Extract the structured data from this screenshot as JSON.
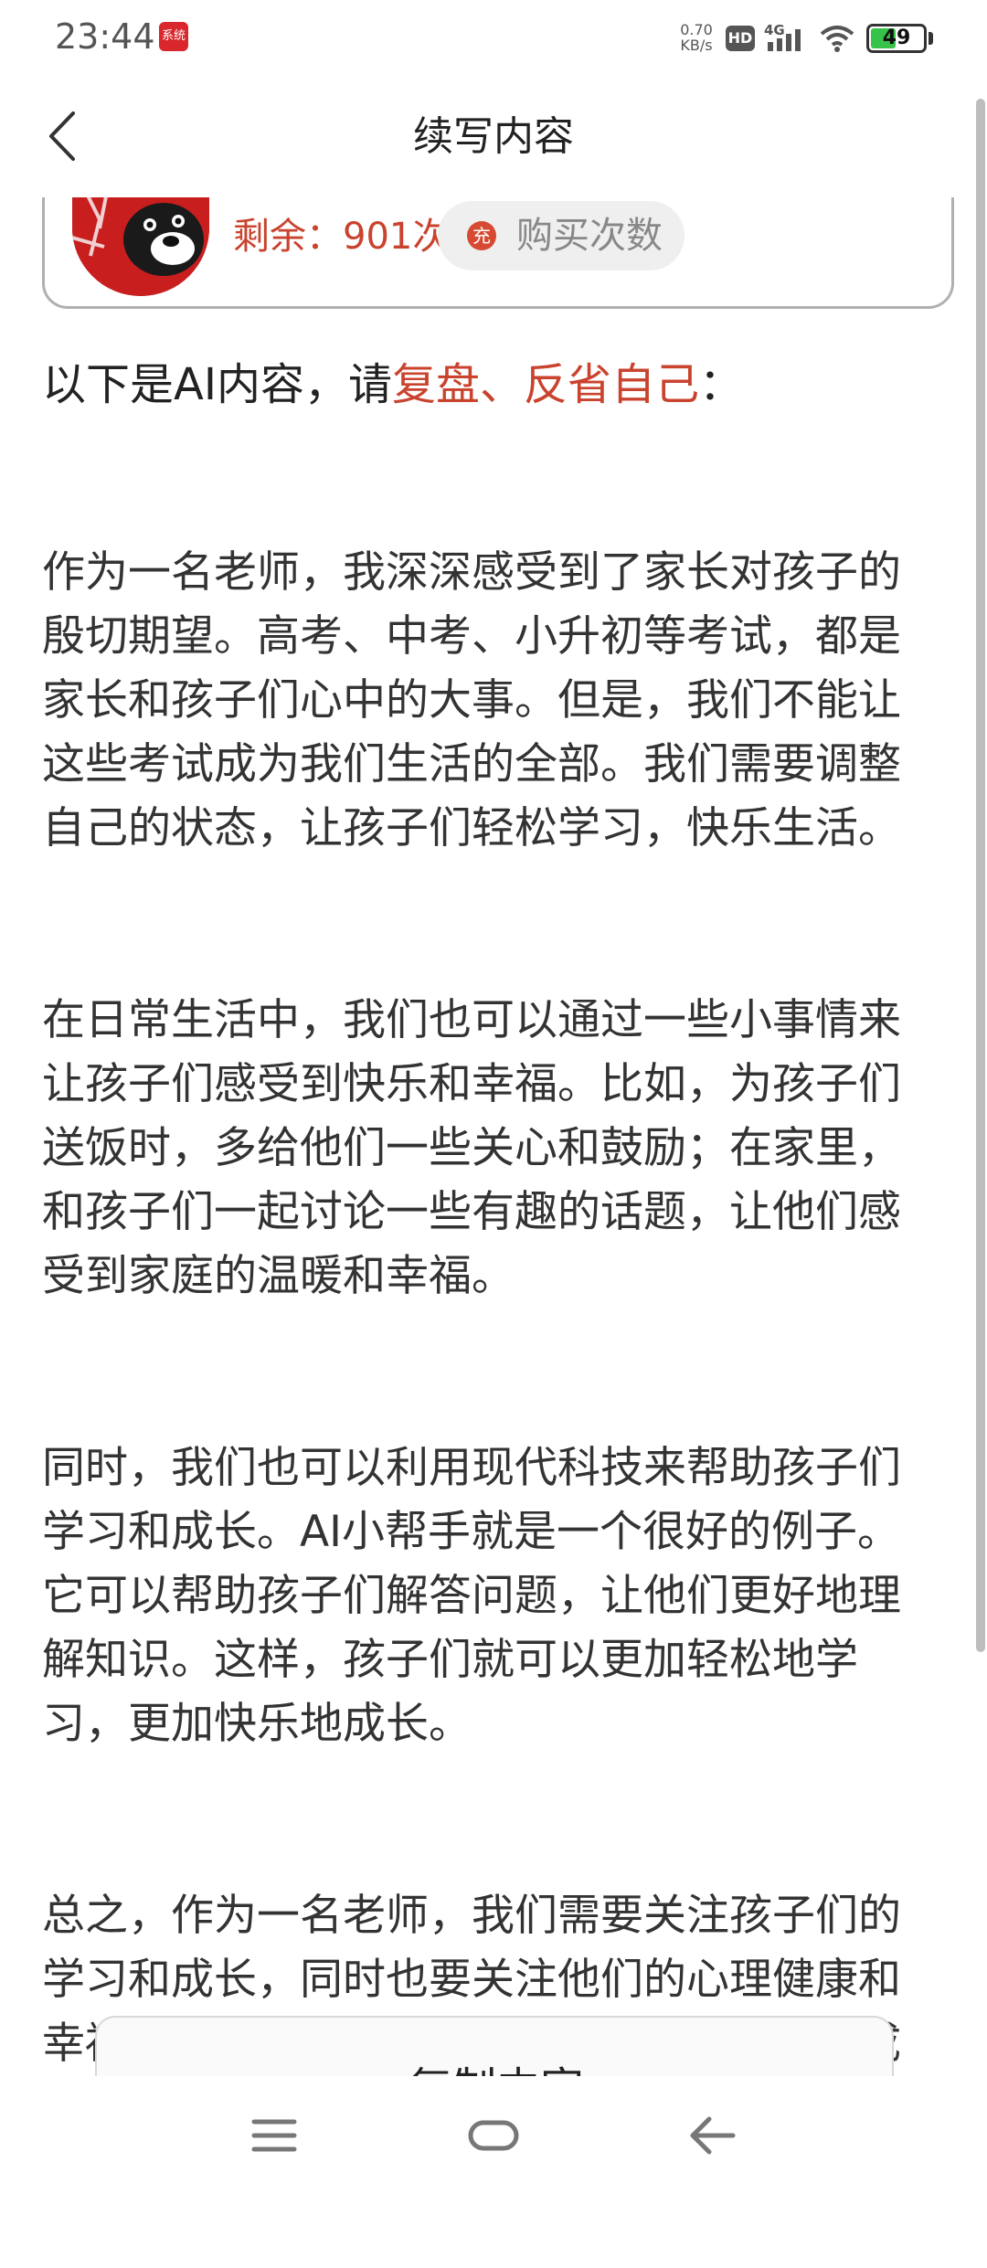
{
  "status_bar": {
    "time": "23:44",
    "app_badge": "系统",
    "net_speed_value": "0.70",
    "net_speed_unit": "KB/s",
    "hd_label": "HD",
    "network": "4G",
    "battery_level": "49",
    "battery_color": "#37c24a"
  },
  "header": {
    "title": "续写内容",
    "back_icon": "chevron-left-icon"
  },
  "quota": {
    "remaining_label": "剩余：",
    "remaining_count": "901次",
    "buy_icon_text": "充",
    "buy_label": "购买次数"
  },
  "intro": {
    "prefix": "以下是AI内容，请",
    "highlight": "复盘、反省自己",
    "suffix": "："
  },
  "article": {
    "paragraphs": [
      "作为一名老师，我深深感受到了家长对孩子的殷切期望。高考、中考、小升初等考试，都是家长和孩子们心中的大事。但是，我们不能让这些考试成为我们生活的全部。我们需要调整自己的状态，让孩子们轻松学习，快乐生活。",
      "在日常生活中，我们也可以通过一些小事情来让孩子们感受到快乐和幸福。比如，为孩子们送饭时，多给他们一些关心和鼓励；在家里，和孩子们一起讨论一些有趣的话题，让他们感受到家庭的温暖和幸福。",
      "同时，我们也可以利用现代科技来帮助孩子们学习和成长。AI小帮手就是一个很好的例子。它可以帮助孩子们解答问题，让他们更好地理解知识。这样，孩子们就可以更加轻松地学习，更加快乐地成长。",
      "总之，作为一名老师，我们需要关注孩子们的学习和成长，同时也要关注他们的心理健康和幸福感。只有这样，我们才能真正帮助他们成长为有用的人才，为社会做出更大的贡献。"
    ]
  },
  "copy_button": {
    "label": "复制内容"
  },
  "nav": {
    "menu_icon": "menu-icon",
    "home_icon": "home-icon",
    "back_icon": "back-arrow-icon"
  },
  "colors": {
    "accent": "#c9432e",
    "text": "#333333"
  }
}
